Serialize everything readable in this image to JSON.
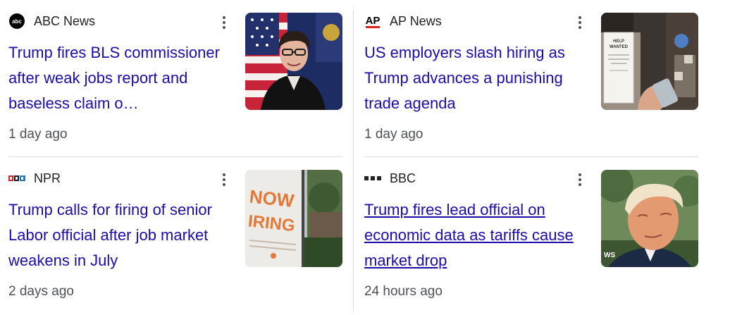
{
  "articles": [
    {
      "source": "ABC News",
      "source_logo": "abc-news-logo",
      "headline": "Trump fires BLS commissioner after weak jobs report and baseless claim o…",
      "time": "1 day ago",
      "thumbnail": "woman-in-front-of-flags-photo",
      "more_icon": "more-vert-icon"
    },
    {
      "source": "AP News",
      "source_logo": "ap-news-logo",
      "logo_text": "AP",
      "headline": "US employers slash hiring as Trump advances a punishing trade agenda",
      "time": "1 day ago",
      "thumbnail": "help-wanted-sign-photo",
      "thumb_sign_text": "HELP WANTED",
      "more_icon": "more-vert-icon"
    },
    {
      "source": "NPR",
      "source_logo": "npr-logo",
      "headline": "Trump calls for firing of senior Labor official after job market weakens in July",
      "time": "2 days ago",
      "thumbnail": "now-hiring-sign-photo",
      "thumb_sign_text": "NOW HIRING",
      "more_icon": "more-vert-icon"
    },
    {
      "source": "BBC",
      "source_logo": "bbc-logo",
      "headline": "Trump fires lead official on economic data as tariffs cause market drop",
      "time": "24 hours ago",
      "thumbnail": "trump-portrait-photo",
      "thumb_watermark": "WS",
      "more_icon": "more-vert-icon"
    }
  ],
  "colors": {
    "headline": "#1a0dab",
    "meta": "#4d5156",
    "divider": "#dadce0",
    "ap_red": "#e0201b",
    "npr_red": "#d62021",
    "npr_blue": "#237bbd"
  }
}
